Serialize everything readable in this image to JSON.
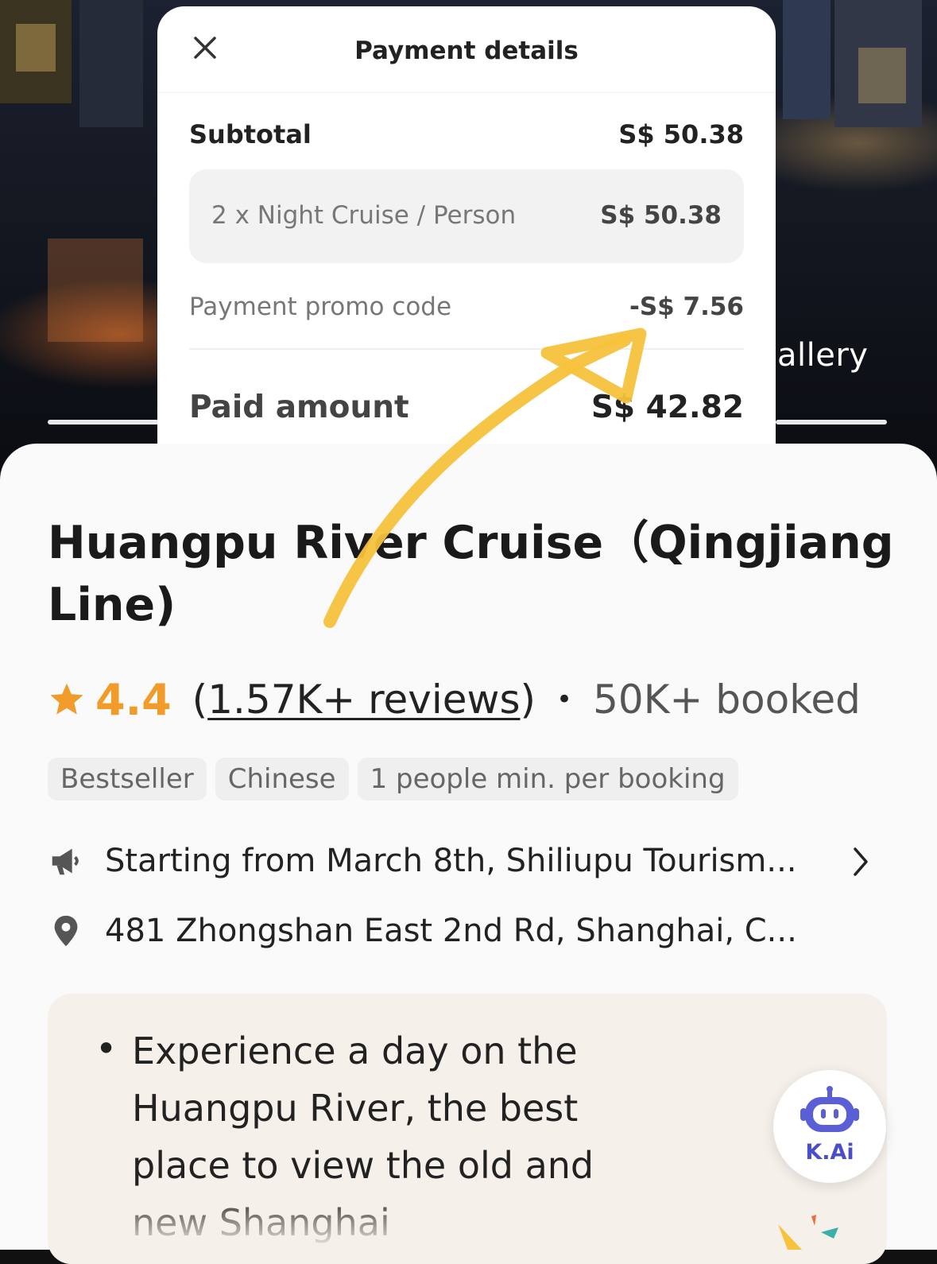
{
  "modal": {
    "title": "Payment details",
    "subtotal_label": "Subtotal",
    "subtotal_value": "S$ 50.38",
    "item_label": "2 x Night Cruise / Person",
    "item_value": "S$ 50.38",
    "promo_label": "Payment promo code",
    "promo_value": "-S$ 7.56",
    "paid_label": "Paid amount",
    "paid_value": "S$ 42.82"
  },
  "hero": {
    "gallery_text": "allery"
  },
  "product": {
    "title": "Huangpu River Cruise（Qingjiang Line)",
    "rating": "4.4",
    "reviews_open": "(",
    "reviews_link": "1.57K+ reviews",
    "reviews_close": ")",
    "bullet_dot": "•",
    "booked": "50K+ booked",
    "tags": [
      "Bestseller",
      "Chinese",
      "1 people min. per booking"
    ],
    "notice": "Starting from March 8th, Shiliupu Tourism...",
    "address": "481 Zhongshan East 2nd Rd, Shanghai, C...",
    "highlight_bullet": "•",
    "highlight": "Experience a day on the Huangpu River, the best place to view the old and new Shanghai"
  },
  "assistant": {
    "label": "K.Ai"
  },
  "colors": {
    "accent_orange": "#f09b2a",
    "annotation_yellow": "#f7c23c",
    "kai_purple": "#5b5fd6"
  },
  "icons": [
    "close-icon",
    "star-icon",
    "megaphone-icon",
    "location-pin-icon",
    "chevron-right-icon",
    "robot-icon"
  ]
}
